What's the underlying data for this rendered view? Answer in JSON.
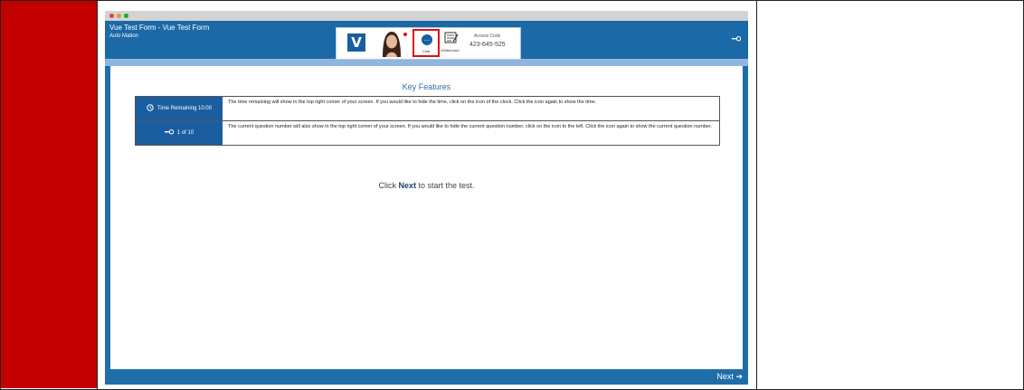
{
  "window": {
    "title": "Vue Test Form - Vue Test Form",
    "subtitle": "Auto Mation",
    "controls": [
      "close",
      "minimize",
      "maximize"
    ]
  },
  "toolbar": {
    "logo_letter": "V",
    "chat_label": "Chat",
    "whiteboard_label": "Whiteboard",
    "access_code_label": "Access Code",
    "access_code_value": "423-645-525"
  },
  "content": {
    "section_title": "Key Features",
    "features": [
      {
        "badge": "Time Remaining 10:00",
        "icon": "clock-icon",
        "description": "The time remaining will show in the top right corner of your screen. If you would like to hide the time, click on the icon of the clock. Click the icon again to show the time."
      },
      {
        "badge": "1 of 10",
        "icon": "question-number-icon",
        "description": "The current question number will also show in the top right corner of your screen. If you would like to hide the current question number, click on the icon to the left. Click the icon again to show the current question number."
      }
    ],
    "start_prefix": "Click",
    "start_bold": "Next",
    "start_suffix": "to start the test."
  },
  "footer": {
    "next_label": "Next",
    "next_icon": "➔"
  },
  "colors": {
    "sidebar_red": "#c20000",
    "header_blue": "#1b69a6",
    "band_blue": "#8fb6df",
    "accent_blue": "#1b5ea0",
    "chat_highlight": "#dd1111"
  }
}
